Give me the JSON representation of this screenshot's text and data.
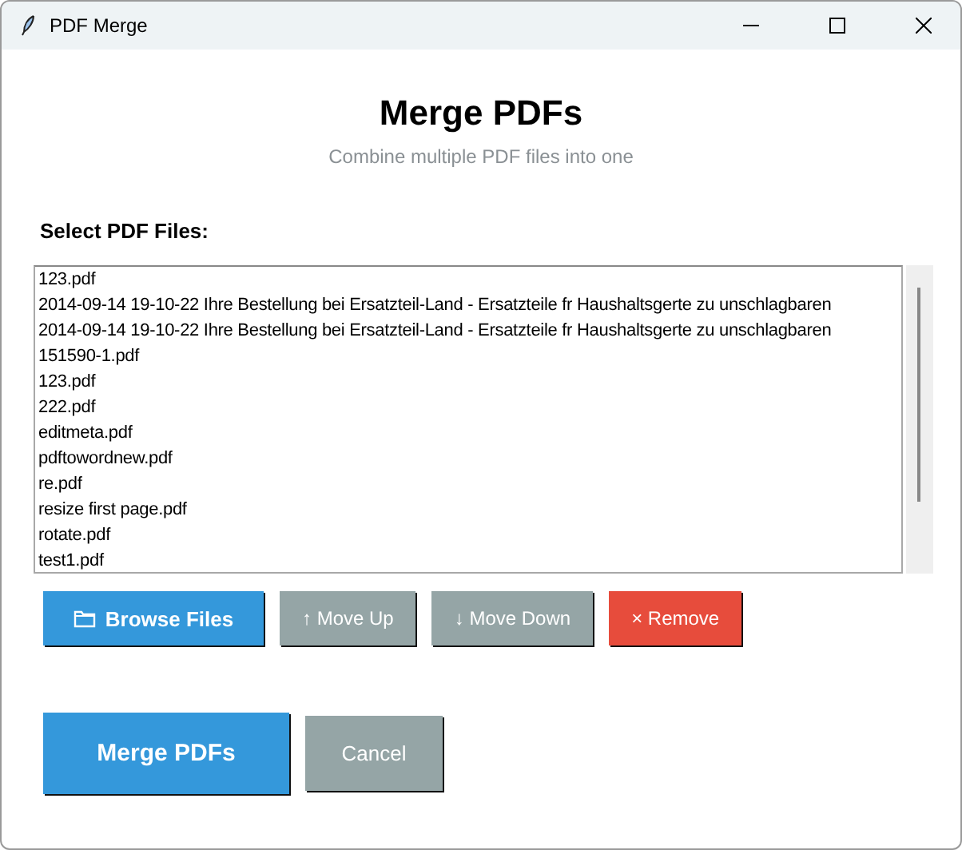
{
  "window": {
    "title": "PDF Merge"
  },
  "header": {
    "title": "Merge PDFs",
    "subtitle": "Combine multiple PDF files into one"
  },
  "files": {
    "label": "Select PDF Files:",
    "items": [
      "123.pdf",
      "2014-09-14 19-10-22 Ihre Bestellung bei Ersatzteil-Land - Ersatzteile fr Haushaltsgerte zu unschlagbaren",
      "2014-09-14 19-10-22 Ihre Bestellung bei Ersatzteil-Land - Ersatzteile fr Haushaltsgerte zu unschlagbaren",
      "151590-1.pdf",
      "123.pdf",
      "222.pdf",
      "editmeta.pdf",
      "pdftowordnew.pdf",
      "re.pdf",
      "resize first page.pdf",
      "rotate.pdf",
      "test1.pdf"
    ]
  },
  "list_buttons": [
    {
      "label": "Browse Files",
      "kind": "primary"
    },
    {
      "label": "↑ Move Up",
      "kind": "secondary"
    },
    {
      "label": "↓ Move Down",
      "kind": "secondary"
    },
    {
      "label": "× Remove",
      "kind": "danger"
    }
  ],
  "actions": [
    {
      "label": "Merge PDFs",
      "kind": "primary"
    },
    {
      "label": "Cancel",
      "kind": "secondary"
    }
  ]
}
